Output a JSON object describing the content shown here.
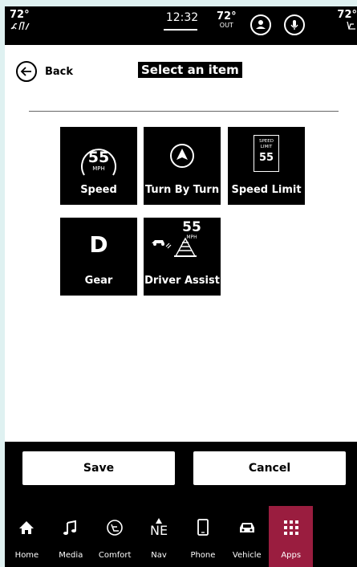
{
  "status": {
    "cabin_temp": "72°",
    "time": "12:32",
    "out_temp": "72°",
    "out_label": "OUT",
    "right_temp": "72°"
  },
  "back": {
    "label": "Back"
  },
  "title": "Select an item",
  "tiles": [
    {
      "id": "speed",
      "label": "Speed",
      "value": "55",
      "unit": "MPH"
    },
    {
      "id": "turn-by-turn",
      "label": "Turn By Turn"
    },
    {
      "id": "speed-limit",
      "label": "Speed Limit",
      "sign_top": "SPEED",
      "sign_mid": "LIMIT",
      "value": "55"
    },
    {
      "id": "gear",
      "label": "Gear",
      "value": "D"
    },
    {
      "id": "driver-assist",
      "label": "Driver Assist",
      "value": "55",
      "unit": "MPH"
    }
  ],
  "buttons": {
    "save": "Save",
    "cancel": "Cancel"
  },
  "nav": [
    {
      "label": "Home",
      "icon": "home-icon"
    },
    {
      "label": "Media",
      "icon": "music-note-icon"
    },
    {
      "label": "Comfort",
      "icon": "comfort-seat-icon"
    },
    {
      "label": "Nav",
      "icon": "compass-icon",
      "heading": "NE"
    },
    {
      "label": "Phone",
      "icon": "phone-icon"
    },
    {
      "label": "Vehicle",
      "icon": "vehicle-icon"
    },
    {
      "label": "Apps",
      "icon": "apps-grid-icon",
      "active": true
    }
  ],
  "colors": {
    "active_nav": "#9a1d3f",
    "background": "#dff1f1"
  }
}
